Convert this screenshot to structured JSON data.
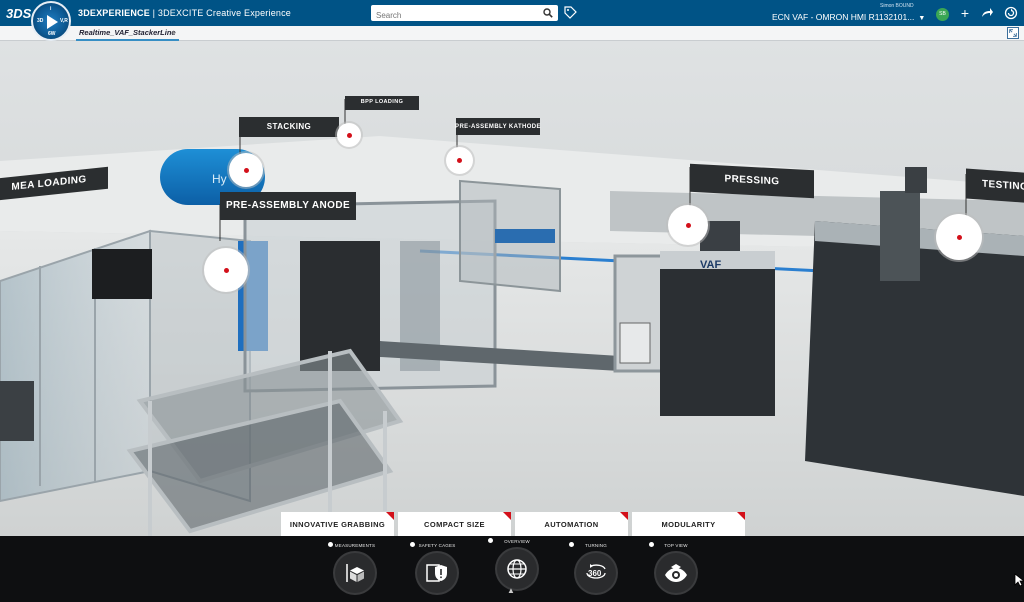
{
  "app": {
    "brand_name": "3DEXPERIENCE",
    "product": "| 3DEXCITE Creative Experience",
    "logo_text": "3DS",
    "compass_quadrants": [
      "3D",
      "V,R",
      "i",
      "6W"
    ]
  },
  "header": {
    "search_placeholder": "Search",
    "user_name": "Simon BOUND",
    "context": "ECN VAF - OMRON HMI R1132101...",
    "avatar_initials": "SB"
  },
  "tabs": [
    {
      "label": "Realtime_VAF_StackerLine",
      "active": true
    }
  ],
  "scene": {
    "stations": [
      {
        "label": "MEA LOADING"
      },
      {
        "label": "STACKING"
      },
      {
        "label": "BPP LOADING"
      },
      {
        "label": "PRE-ASSEMBLY KATHODE"
      },
      {
        "label": "PRE-ASSEMBLY ANODE"
      },
      {
        "label": "PRESSING"
      },
      {
        "label": "TESTING"
      }
    ],
    "machine_branding": "VAF",
    "tank_text": "Hy"
  },
  "feature_tabs": [
    {
      "label": "INNOVATIVE GRABBING"
    },
    {
      "label": "COMPACT SIZE"
    },
    {
      "label": "AUTOMATION"
    },
    {
      "label": "MODULARITY"
    }
  ],
  "views": [
    {
      "label": "MEASUREMENTS",
      "icon": "cube-measure-icon"
    },
    {
      "label": "SAFETY CAGES",
      "icon": "safety-shield-icon"
    },
    {
      "label": "OVERVIEW",
      "icon": "globe-icon",
      "active": true
    },
    {
      "label": "TURNING",
      "icon": "rotate-360-icon"
    },
    {
      "label": "TOP VIEW",
      "icon": "eye-icon"
    }
  ],
  "colors": {
    "topbar": "#005386",
    "accent_red": "#d3101a",
    "label_plate": "#2b2e30",
    "bottom_bar": "#0e0f11"
  }
}
